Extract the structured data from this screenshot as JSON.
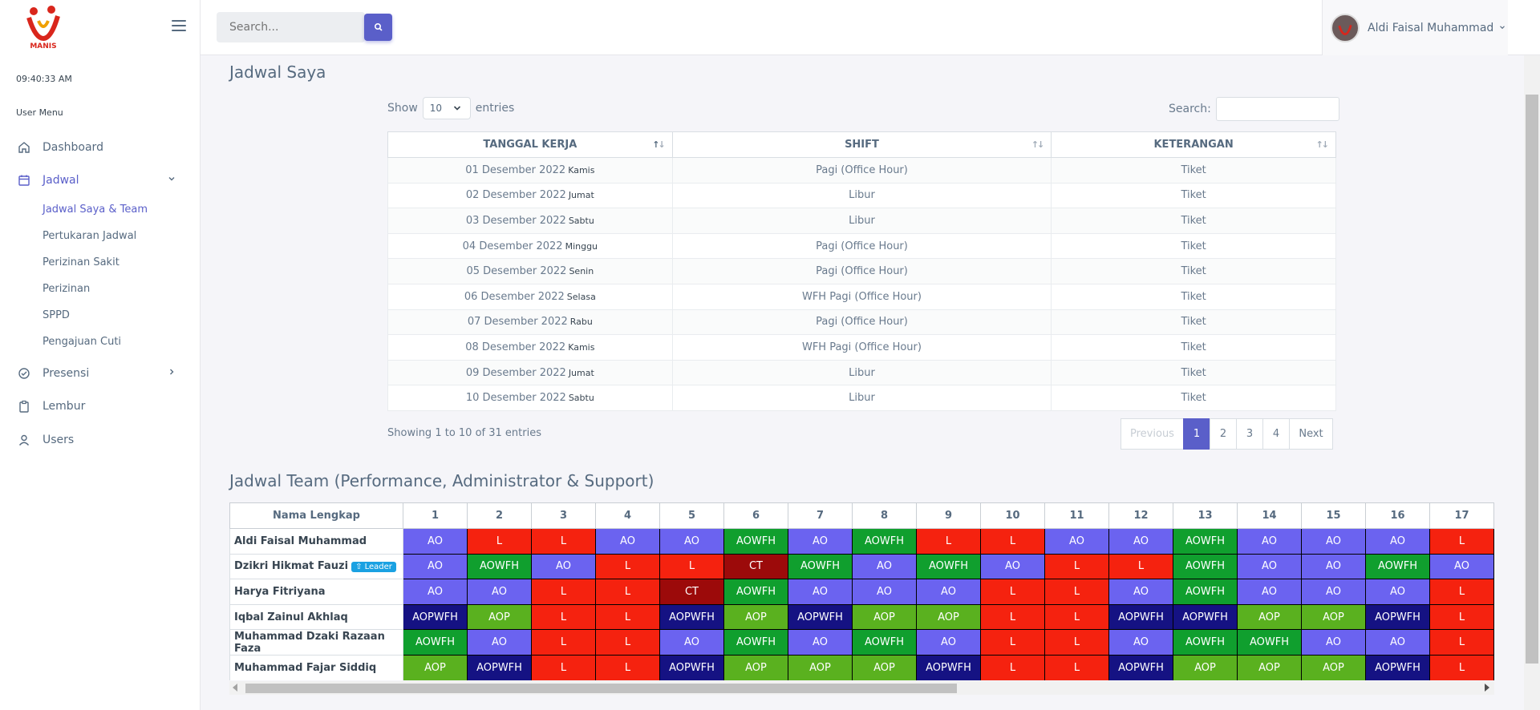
{
  "brand": {
    "logo_text": "MANIS"
  },
  "clock": "09:40:33 AM",
  "sidebar": {
    "section_label": "User Menu",
    "items": [
      {
        "label": "Dashboard",
        "icon": "home-icon"
      },
      {
        "label": "Jadwal",
        "icon": "calendar-icon"
      },
      {
        "label": "Presensi",
        "icon": "check-circle-icon"
      },
      {
        "label": "Lembur",
        "icon": "clipboard-icon"
      },
      {
        "label": "Users",
        "icon": "user-icon"
      }
    ],
    "jadwal_sub": [
      "Jadwal Saya & Team",
      "Pertukaran Jadwal",
      "Perizinan Sakit",
      "Perizinan",
      "SPPD",
      "Pengajuan Cuti"
    ]
  },
  "topbar": {
    "search_placeholder": "Search...",
    "user_name": "Aldi Faisal Muhammad"
  },
  "jadwal_saya": {
    "title": "Jadwal Saya",
    "show_label": "Show",
    "entries_label": "entries",
    "page_length": "10",
    "search_label": "Search:",
    "columns": [
      "TANGGAL KERJA",
      "SHIFT",
      "KETERANGAN"
    ],
    "rows": [
      {
        "date": "01 Desember 2022",
        "day": "Kamis",
        "shift": "Pagi (Office Hour)",
        "ket": "Tiket"
      },
      {
        "date": "02 Desember 2022",
        "day": "Jumat",
        "shift": "Libur",
        "ket": "Tiket"
      },
      {
        "date": "03 Desember 2022",
        "day": "Sabtu",
        "shift": "Libur",
        "ket": "Tiket"
      },
      {
        "date": "04 Desember 2022",
        "day": "Minggu",
        "shift": "Pagi (Office Hour)",
        "ket": "Tiket"
      },
      {
        "date": "05 Desember 2022",
        "day": "Senin",
        "shift": "Pagi (Office Hour)",
        "ket": "Tiket"
      },
      {
        "date": "06 Desember 2022",
        "day": "Selasa",
        "shift": "WFH Pagi (Office Hour)",
        "ket": "Tiket"
      },
      {
        "date": "07 Desember 2022",
        "day": "Rabu",
        "shift": "Pagi (Office Hour)",
        "ket": "Tiket"
      },
      {
        "date": "08 Desember 2022",
        "day": "Kamis",
        "shift": "WFH Pagi (Office Hour)",
        "ket": "Tiket"
      },
      {
        "date": "09 Desember 2022",
        "day": "Jumat",
        "shift": "Libur",
        "ket": "Tiket"
      },
      {
        "date": "10 Desember 2022",
        "day": "Sabtu",
        "shift": "Libur",
        "ket": "Tiket"
      }
    ],
    "info": "Showing 1 to 10 of 31 entries",
    "pagination": [
      "Previous",
      "1",
      "2",
      "3",
      "4",
      "Next"
    ],
    "current_page": "1"
  },
  "jadwal_team": {
    "title": "Jadwal Team (Performance, Administrator & Support)",
    "name_header": "Nama Lengkap",
    "days": [
      "1",
      "2",
      "3",
      "4",
      "5",
      "6",
      "7",
      "8",
      "9",
      "10",
      "11",
      "12",
      "13",
      "14",
      "15",
      "16",
      "17"
    ],
    "leader_label": "Leader",
    "code_colors": {
      "AO": "#6b63f0",
      "L": "#f5220f",
      "AOWFH": "#109f2e",
      "CT": "#9c0a0a",
      "AOPWFH": "#151283",
      "AOP": "#5ab11f"
    },
    "members": [
      {
        "name": "Aldi Faisal Muhammad",
        "leader": false,
        "shifts": [
          "AO",
          "L",
          "L",
          "AO",
          "AO",
          "AOWFH",
          "AO",
          "AOWFH",
          "L",
          "L",
          "AO",
          "AO",
          "AOWFH",
          "AO",
          "AO",
          "AO",
          "L"
        ]
      },
      {
        "name": "Dzikri Hikmat Fauzi",
        "leader": true,
        "shifts": [
          "AO",
          "AOWFH",
          "AO",
          "L",
          "L",
          "CT",
          "AOWFH",
          "AO",
          "AOWFH",
          "AO",
          "L",
          "L",
          "AOWFH",
          "AO",
          "AO",
          "AOWFH",
          "AO"
        ]
      },
      {
        "name": "Harya Fitriyana",
        "leader": false,
        "shifts": [
          "AO",
          "AO",
          "L",
          "L",
          "CT",
          "AOWFH",
          "AO",
          "AO",
          "AO",
          "L",
          "L",
          "AO",
          "AOWFH",
          "AO",
          "AO",
          "AO",
          "L"
        ]
      },
      {
        "name": "Iqbal Zainul Akhlaq",
        "leader": false,
        "shifts": [
          "AOPWFH",
          "AOP",
          "L",
          "L",
          "AOPWFH",
          "AOP",
          "AOPWFH",
          "AOP",
          "AOP",
          "L",
          "L",
          "AOPWFH",
          "AOPWFH",
          "AOP",
          "AOP",
          "AOPWFH",
          "L"
        ]
      },
      {
        "name": "Muhammad Dzaki Razaan Faza",
        "leader": false,
        "shifts": [
          "AOWFH",
          "AO",
          "L",
          "L",
          "AO",
          "AOWFH",
          "AO",
          "AOWFH",
          "AO",
          "L",
          "L",
          "AO",
          "AOWFH",
          "AOWFH",
          "AO",
          "AO",
          "L"
        ]
      },
      {
        "name": "Muhammad Fajar Siddiq",
        "leader": false,
        "shifts": [
          "AOP",
          "AOPWFH",
          "L",
          "L",
          "AOPWFH",
          "AOP",
          "AOP",
          "AOP",
          "AOPWFH",
          "L",
          "L",
          "AOPWFH",
          "AOP",
          "AOP",
          "AOP",
          "AOPWFH",
          "L"
        ]
      }
    ]
  }
}
